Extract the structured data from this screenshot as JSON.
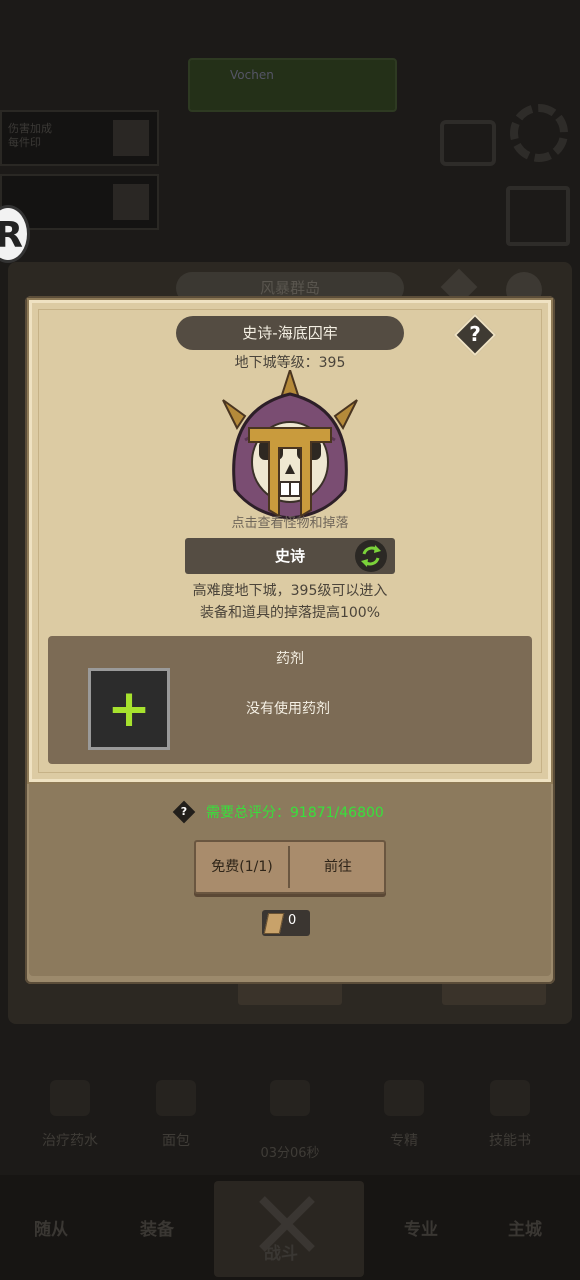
{
  "background": {
    "top_banner": "Vochen",
    "side_box_1": "伤害加成\n每件印",
    "side_box_2": "",
    "gift_label": "",
    "panel_title": "风暴群岛",
    "bottom_buttons": [
      "",
      ""
    ],
    "bottom_items": [
      "治疗药水",
      "面包",
      "",
      "专精",
      "技能书"
    ],
    "timer": "03分06秒",
    "nav": [
      "随从",
      "装备",
      "战斗",
      "专业",
      "主城"
    ]
  },
  "modal": {
    "title": "史诗-海底囚牢",
    "help": "?",
    "level_text": "地下城等级：395",
    "boss_hint": "点击查看怪物和掉落",
    "difficulty": "史诗",
    "description_lines": [
      "高难度地下城，395级可以进入",
      "装备和道具的掉落提高100%"
    ],
    "potion": {
      "title": "药剂",
      "plus": "+",
      "empty_text": "没有使用药剂"
    },
    "score": {
      "icon_text": "?",
      "text": "需要总评分：91871/46800"
    },
    "buttons": {
      "free": "免费(1/1)",
      "go": "前往"
    },
    "ticket_count": "0"
  },
  "colors": {
    "score_green": "#38e03b",
    "potion_plus": "#a7e22e",
    "paper": "#dccba3"
  }
}
